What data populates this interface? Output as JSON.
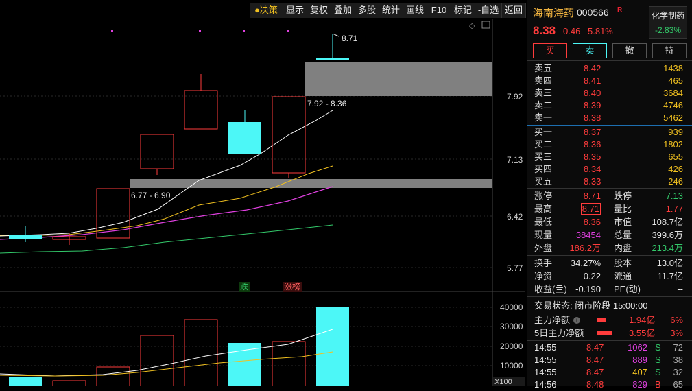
{
  "toolbar": {
    "items": [
      "决策",
      "显示",
      "复权",
      "叠加",
      "多股",
      "统计",
      "画线",
      "F10",
      "标记",
      "-自选",
      "返回"
    ]
  },
  "chart": {
    "price_axis": [
      "7.92",
      "7.13",
      "6.42",
      "5.77"
    ],
    "volume_axis": [
      "40000",
      "30000",
      "20000",
      "10000"
    ],
    "volume_unit": "X100",
    "high_marker": "8.71",
    "zone_upper_label": "7.92 - 8.36",
    "zone_lower_label": "6.77 - 6.90",
    "tag_fall": "跌",
    "tag_limit": "涨榜",
    "colors": {
      "up": "#ff3c3c",
      "down": "#4cf7f7",
      "zone": "#808080",
      "ma5": "#ffffff",
      "ma10": "#f0c020",
      "ma20": "#e040e0",
      "ma60": "#33c96a"
    }
  },
  "stock": {
    "name": "海南海药",
    "code": "000566",
    "flag": "R",
    "price": "8.38",
    "change": "0.46",
    "change_pct": "5.81%",
    "sector_name": "化学制药",
    "sector_pct": "-2.83%"
  },
  "trade_buttons": [
    "买",
    "卖",
    "撤",
    "持"
  ],
  "order_book": {
    "asks": [
      {
        "label": "卖五",
        "price": "8.42",
        "vol": "1438"
      },
      {
        "label": "卖四",
        "price": "8.41",
        "vol": "465"
      },
      {
        "label": "卖三",
        "price": "8.40",
        "vol": "3684"
      },
      {
        "label": "卖二",
        "price": "8.39",
        "vol": "4746"
      },
      {
        "label": "卖一",
        "price": "8.38",
        "vol": "5462"
      }
    ],
    "bids": [
      {
        "label": "买一",
        "price": "8.37",
        "vol": "939"
      },
      {
        "label": "买二",
        "price": "8.36",
        "vol": "1802"
      },
      {
        "label": "买三",
        "price": "8.35",
        "vol": "655"
      },
      {
        "label": "买四",
        "price": "8.34",
        "vol": "426"
      },
      {
        "label": "买五",
        "price": "8.33",
        "vol": "246"
      }
    ]
  },
  "stats": {
    "zhangting_l": "涨停",
    "zhangting_v": "8.71",
    "dieting_l": "跌停",
    "dieting_v": "7.13",
    "zuigao_l": "最高",
    "zuigao_v": "8.71",
    "liangbi_l": "量比",
    "liangbi_v": "1.77",
    "zuidi_l": "最低",
    "zuidi_v": "8.36",
    "shizhi_l": "市值",
    "shizhi_v": "108.7亿",
    "xianliang_l": "现量",
    "xianliang_v": "38454",
    "zongliang_l": "总量",
    "zongliang_v": "399.6万",
    "waipan_l": "外盘",
    "waipan_v": "186.2万",
    "neipan_l": "内盘",
    "neipan_v": "213.4万",
    "huanshou_l": "换手",
    "huanshou_v": "34.27%",
    "guben_l": "股本",
    "guben_v": "13.0亿",
    "jingzi_l": "净资",
    "jingzi_v": "0.22",
    "liutong_l": "流通",
    "liutong_v": "11.7亿",
    "shouyi_l": "收益(亖)",
    "shouyi_v": "-0.190",
    "pe_l": "PE(动)",
    "pe_v": "--"
  },
  "status": "交易状态: 闭市阶段 15:00:00",
  "flows": [
    {
      "label": "主力净额",
      "value": "1.94亿",
      "pct": "6%"
    },
    {
      "label": "5日主力净额",
      "value": "3.55亿",
      "pct": "3%"
    }
  ],
  "ticks": [
    {
      "time": "14:55",
      "price": "8.47",
      "vol": "1062",
      "side": "S",
      "n": "72"
    },
    {
      "time": "14:55",
      "price": "8.47",
      "vol": "889",
      "side": "S",
      "n": "38"
    },
    {
      "time": "14:55",
      "price": "8.47",
      "vol": "407",
      "side": "S",
      "n": "32"
    },
    {
      "time": "14:56",
      "price": "8.48",
      "vol": "829",
      "side": "B",
      "n": "65"
    }
  ]
}
